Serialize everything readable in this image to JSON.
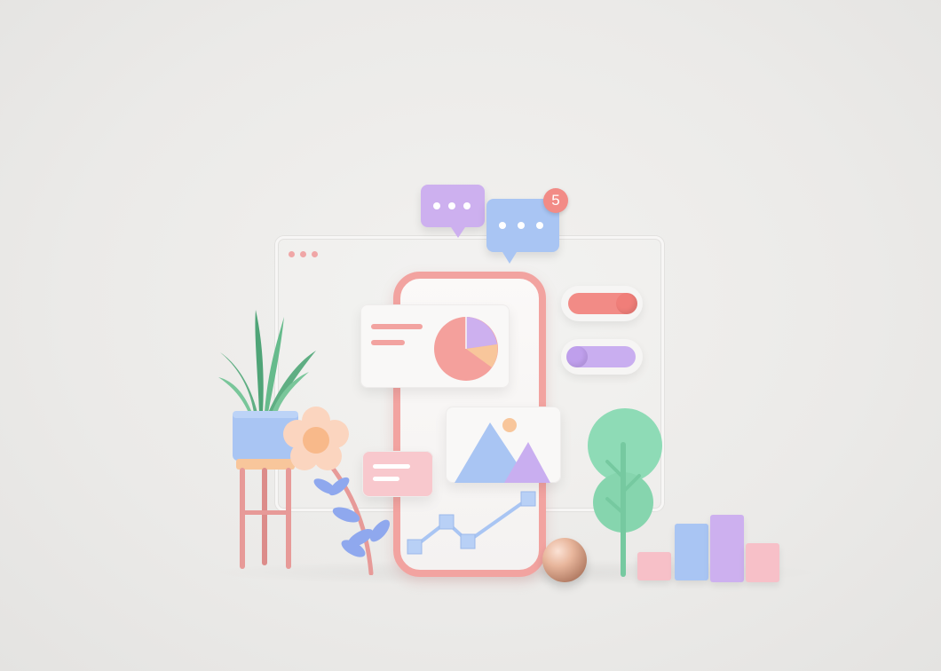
{
  "scene": {
    "window_dots": [
      "dot",
      "dot",
      "dot"
    ],
    "notification": {
      "count": "5"
    },
    "chat_bubbles": [
      {
        "color": "#cdb0ef"
      },
      {
        "color": "#a9c5f3"
      }
    ],
    "toggles": [
      {
        "state": "on",
        "track": "#f28b86",
        "knob": "#f28b86"
      },
      {
        "state": "off",
        "track": "#c9aef0",
        "knob": "#c9aef0"
      }
    ],
    "colors": {
      "pink": "#f2a3a0",
      "lavender": "#cdb0ef",
      "blue": "#a9c5f3",
      "mint": "#8edbb6",
      "peach": "#f8c69b"
    },
    "icons": [
      "plant-icon",
      "flower-icon",
      "tree-icon",
      "pie-chart-icon",
      "image-icon",
      "line-chart-icon",
      "sphere-icon",
      "bar-chart-icon"
    ]
  }
}
